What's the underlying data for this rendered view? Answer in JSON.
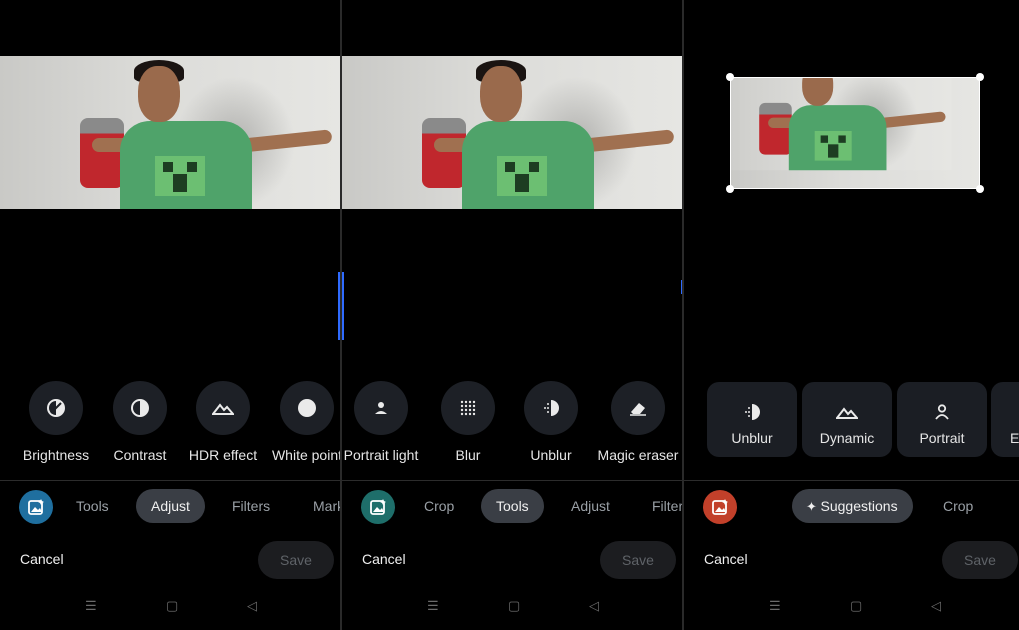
{
  "panels": [
    {
      "tools": [
        {
          "label": "Brightness",
          "icon": "brightness-icon"
        },
        {
          "label": "Contrast",
          "icon": "contrast-icon"
        },
        {
          "label": "HDR effect",
          "icon": "mountain-icon"
        },
        {
          "label": "White point",
          "icon": "white-point-icon"
        }
      ],
      "tabs": [
        "Tools",
        "Adjust",
        "Filters",
        "Mark"
      ],
      "active_tab": "Adjust",
      "cancel_label": "Cancel",
      "save_label": "Save"
    },
    {
      "tools": [
        {
          "label": "Portrait light",
          "icon": "portrait-light-icon"
        },
        {
          "label": "Blur",
          "icon": "blur-icon"
        },
        {
          "label": "Unblur",
          "icon": "unblur-icon"
        },
        {
          "label": "Magic eraser",
          "icon": "eraser-icon"
        }
      ],
      "tabs": [
        "Crop",
        "Tools",
        "Adjust",
        "Filter"
      ],
      "active_tab": "Tools",
      "cancel_label": "Cancel",
      "save_label": "Save"
    },
    {
      "cards": [
        {
          "label": "Unblur",
          "icon": "unblur-icon"
        },
        {
          "label": "Dynamic",
          "icon": "mountain-icon"
        },
        {
          "label": "Portrait",
          "icon": "person-icon"
        },
        {
          "label": "E",
          "icon": "partial-icon"
        }
      ],
      "tabs": [
        "Suggestions",
        "Crop"
      ],
      "active_tab": "Suggestions",
      "cancel_label": "Cancel",
      "save_label": "Save"
    }
  ],
  "colors": {
    "accent_blue_app": "#1f6f9f",
    "accent_red_app": "#c2402a",
    "active_tab_bg": "#3a3e45"
  }
}
